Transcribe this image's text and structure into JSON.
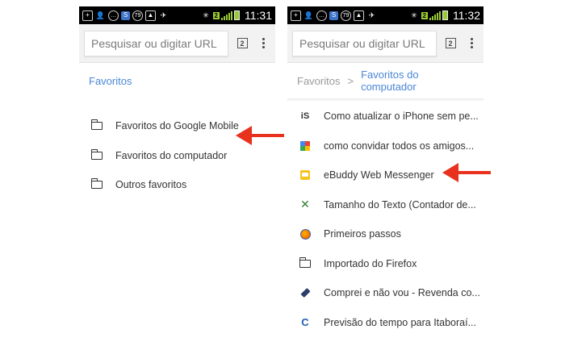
{
  "colors": {
    "link_blue": "#4a86d6",
    "arrow_red": "#e8321e",
    "status_green": "#99cc33"
  },
  "left": {
    "status": {
      "time": "11:31",
      "icons": [
        "plus-icon",
        "person-icon",
        "chat-icon",
        "skype-icon",
        "79-badge-icon",
        "image-icon",
        "signal-icon",
        "wifi-icon",
        "battery-icon"
      ],
      "badge_79": "79",
      "wifi_badge": "2"
    },
    "toolbar": {
      "url_placeholder": "Pesquisar ou digitar URL",
      "tab_count": "2"
    },
    "breadcrumb": {
      "current": "Favoritos"
    },
    "items": [
      {
        "icon": "folder-icon",
        "label": "Favoritos do Google Mobile"
      },
      {
        "icon": "folder-icon",
        "label": "Favoritos do computador"
      },
      {
        "icon": "folder-icon",
        "label": "Outros favoritos"
      }
    ]
  },
  "right": {
    "status": {
      "time": "11:32",
      "badge_79": "79",
      "wifi_badge": "2"
    },
    "toolbar": {
      "url_placeholder": "Pesquisar ou digitar URL",
      "tab_count": "2"
    },
    "breadcrumb": {
      "parent": "Favoritos",
      "separator": ">",
      "current": "Favoritos do computador"
    },
    "items": [
      {
        "icon": "is-favicon",
        "label": "Como atualizar o iPhone sem pe..."
      },
      {
        "icon": "google-favicon",
        "label": "como convidar todos os amigos..."
      },
      {
        "icon": "ebuddy-favicon",
        "label": "eBuddy Web Messenger"
      },
      {
        "icon": "x-favicon",
        "label": "Tamanho do Texto (Contador de..."
      },
      {
        "icon": "firefox-favicon",
        "label": "Primeiros passos"
      },
      {
        "icon": "folder-icon",
        "label": "Importado do Firefox"
      },
      {
        "icon": "tag-favicon",
        "label": "Comprei e não vou - Revenda co..."
      },
      {
        "icon": "c-favicon",
        "label": "Previsão do tempo para Itaboraí..."
      }
    ]
  },
  "favicon_text": {
    "is": "iS",
    "x": "✕",
    "c": "C"
  }
}
